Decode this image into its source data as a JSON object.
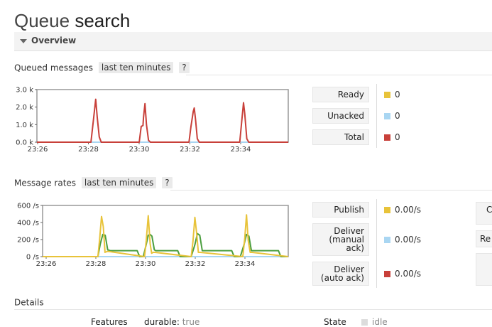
{
  "page": {
    "title_prefix": "Queue",
    "title_name": "search"
  },
  "overview": {
    "label": "Overview"
  },
  "queued": {
    "header": "Queued messages",
    "range": "last ten minutes",
    "help": "?",
    "legend": [
      {
        "label": "Ready",
        "value": "0",
        "color": "#e8c33a"
      },
      {
        "label": "Unacked",
        "value": "0",
        "color": "#a9d6f2"
      },
      {
        "label": "Total",
        "value": "0",
        "color": "#c8403a"
      }
    ]
  },
  "rates": {
    "header": "Message rates",
    "range": "last ten minutes",
    "help": "?",
    "legend": [
      {
        "label": "Publish",
        "value": "0.00/s",
        "color": "#e8c33a"
      },
      {
        "label": "Deliver (manual ack)",
        "line1": "Deliver",
        "line2": "(manual",
        "line3": "ack)",
        "value": "0.00/s",
        "color": "#a9d6f2"
      },
      {
        "label": "Deliver (auto ack)",
        "line1": "Deliver",
        "line2": "(auto ack)",
        "value": "0.00/s",
        "color": "#c8403a"
      }
    ],
    "cut_labels": [
      "C",
      "Re"
    ]
  },
  "details": {
    "header": "Details",
    "features_label": "Features",
    "durable_key": "durable:",
    "durable_val": "true",
    "state_label": "State",
    "state_val": "idle"
  },
  "chart_data": [
    {
      "type": "line",
      "ylim": [
        0,
        3000
      ],
      "yticks": [
        "0.0 k",
        "1.0 k",
        "2.0 k",
        "3.0 k"
      ],
      "xticks": [
        "23:26",
        "23:28",
        "23:30",
        "23:32",
        "23:34"
      ],
      "series": [
        {
          "name": "Total",
          "color": "#c8403a",
          "x": [
            0,
            21.5,
            22.5,
            23.4,
            24.0,
            24.8,
            25.6,
            40.7,
            41.5,
            42.2,
            42.4,
            43.0,
            43.6,
            44.4,
            45.2,
            60.5,
            61.3,
            62.2,
            62.6,
            63.1,
            63.8,
            64.6,
            80.7,
            81.5,
            82.2,
            82.7,
            83.5,
            84.3,
            100
          ],
          "y": [
            0,
            0,
            1300,
            2450,
            1400,
            300,
            0,
            0,
            900,
            950,
            1400,
            2200,
            1000,
            100,
            0,
            0,
            900,
            1750,
            1950,
            1300,
            200,
            0,
            0,
            1200,
            2250,
            1600,
            200,
            0,
            0
          ]
        },
        {
          "name": "Ready",
          "color": "#e8c33a",
          "x": [
            0,
            100
          ],
          "y": [
            0,
            0
          ]
        },
        {
          "name": "Unacked",
          "color": "#a9d6f2",
          "x": [
            0,
            100
          ],
          "y": [
            0,
            0
          ]
        }
      ]
    },
    {
      "type": "line",
      "ylim": [
        0,
        600
      ],
      "yticks": [
        "0 /s",
        "200 /s",
        "400 /s",
        "600 /s"
      ],
      "xticks": [
        "23:26",
        "23:28",
        "23:30",
        "23:32",
        "23:34"
      ],
      "series": [
        {
          "name": "Publish",
          "color": "#e8c33a",
          "x": [
            0,
            22.5,
            23.2,
            24.0,
            24.7,
            25.4,
            26.2,
            27.0,
            41.5,
            42.2,
            43.0,
            43.8,
            44.4,
            45.0,
            45.8,
            60.5,
            61.2,
            62.0,
            62.7,
            63.4,
            64.2,
            81.5,
            82.3,
            83.0,
            83.7,
            84.5,
            85.3,
            100
          ],
          "y": [
            0,
            0,
            200,
            470,
            350,
            50,
            60,
            60,
            0,
            190,
            480,
            150,
            40,
            50,
            50,
            0,
            180,
            460,
            280,
            50,
            50,
            0,
            220,
            490,
            190,
            50,
            50,
            0
          ]
        },
        {
          "name": "Deliver (auto ack)",
          "color": "#4a9e3e",
          "x": [
            0,
            22.5,
            23.5,
            24.5,
            25.5,
            26.5,
            27.5,
            29,
            38.5,
            39.5,
            41,
            42,
            43.0,
            43.8,
            44.5,
            45.5,
            46,
            55,
            56,
            60.5,
            62.0,
            63.0,
            64.0,
            65.0,
            66,
            77,
            78,
            80.5,
            82.0,
            83.0,
            84.0,
            85.0,
            86,
            96,
            97,
            98.5,
            100
          ],
          "y": [
            0,
            0,
            150,
            260,
            250,
            80,
            70,
            70,
            70,
            0,
            0,
            120,
            250,
            260,
            240,
            80,
            70,
            70,
            0,
            0,
            140,
            270,
            250,
            70,
            70,
            70,
            0,
            0,
            140,
            260,
            240,
            70,
            70,
            70,
            0,
            0,
            0
          ]
        },
        {
          "name": "Deliver (manual ack)",
          "color": "#a9d6f2",
          "x": [
            0,
            100
          ],
          "y": [
            0,
            0
          ]
        }
      ]
    }
  ]
}
